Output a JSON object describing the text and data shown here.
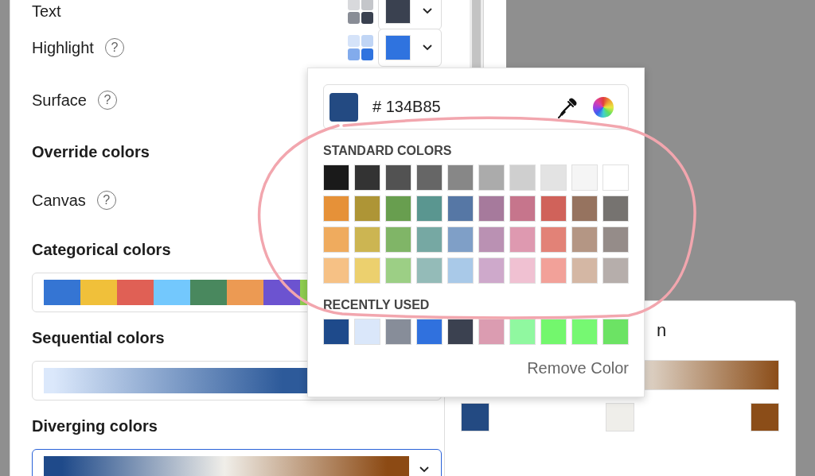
{
  "theme_rows": [
    {
      "kind": "color",
      "label": "Text",
      "color": "#3a4150"
    },
    {
      "kind": "color",
      "label": "Highlight",
      "help": "?",
      "color": "#2f73df"
    },
    {
      "kind": "color",
      "label": "Surface",
      "help": "?"
    },
    {
      "kind": "heading",
      "label": "Override colors"
    },
    {
      "kind": "color",
      "label": "Canvas",
      "help": "?"
    }
  ],
  "palettes": [
    {
      "kind": "categorical",
      "title": "Categorical colors",
      "selected": false,
      "swatches": [
        {
          "color": "#3575d3"
        },
        {
          "color": "#f0c03a"
        },
        {
          "color": "#e06055"
        },
        {
          "color": "#73c8fd"
        },
        {
          "color": "#49885e"
        },
        {
          "color": "#ec9a53"
        },
        {
          "color": "#6c53d0"
        },
        {
          "color": "#8fcf50"
        }
      ]
    },
    {
      "kind": "sequential",
      "title": "Sequential colors",
      "selected": false,
      "swatches": [
        {
          "color": "#dbe8fb"
        },
        {
          "color": "#2d5a9a"
        }
      ]
    },
    {
      "kind": "diverging",
      "title": "Diverging colors",
      "selected": true,
      "swatches": [
        {
          "color": "#1f4a8a"
        },
        {
          "color": "#f0eee9"
        },
        {
          "color": "#8c4a14"
        }
      ]
    }
  ],
  "color_picker": {
    "color": "#234a82",
    "value": "# 134B85",
    "standard_label": "STANDARD COLORS",
    "standard": [
      {
        "color": "#1a1a1a"
      },
      {
        "color": "#333333"
      },
      {
        "color": "#525252"
      },
      {
        "color": "#666666"
      },
      {
        "color": "#878787"
      },
      {
        "color": "#ababab"
      },
      {
        "color": "#cfcfcf"
      },
      {
        "color": "#e3e3e3"
      },
      {
        "color": "#f5f5f5"
      },
      {
        "color": "#ffffff"
      },
      {
        "color": "#e69138"
      },
      {
        "color": "#ae9536"
      },
      {
        "color": "#689e4f"
      },
      {
        "color": "#5a9690"
      },
      {
        "color": "#5677a5"
      },
      {
        "color": "#a67a9c"
      },
      {
        "color": "#c6758c"
      },
      {
        "color": "#d0625a"
      },
      {
        "color": "#96735f"
      },
      {
        "color": "#767370"
      },
      {
        "color": "#efab5e"
      },
      {
        "color": "#ccb552"
      },
      {
        "color": "#80b567"
      },
      {
        "color": "#76a8a3"
      },
      {
        "color": "#7f9fc7"
      },
      {
        "color": "#ba91b3"
      },
      {
        "color": "#de99b0"
      },
      {
        "color": "#e28277"
      },
      {
        "color": "#b49684"
      },
      {
        "color": "#958c89"
      },
      {
        "color": "#f6c185"
      },
      {
        "color": "#ecd06e"
      },
      {
        "color": "#9ccf85"
      },
      {
        "color": "#94bbb8"
      },
      {
        "color": "#a9c9e8"
      },
      {
        "color": "#cea9cb"
      },
      {
        "color": "#f0c1d2"
      },
      {
        "color": "#f2a199"
      },
      {
        "color": "#d4b7a4"
      },
      {
        "color": "#b6aeab"
      }
    ],
    "recent_label": "RECENTLY USED",
    "recent": [
      {
        "color": "#1e4a8b"
      },
      {
        "color": "#dae7fa"
      },
      {
        "color": "#878d99"
      },
      {
        "color": "#3071de"
      },
      {
        "color": "#3b4150"
      },
      {
        "color": "#db9cb1"
      },
      {
        "color": "#90f8a0"
      },
      {
        "color": "#73f76d"
      },
      {
        "color": "#76f872"
      },
      {
        "color": "#6ce364"
      }
    ],
    "remove": "Remove Color"
  },
  "diverging_panel": {
    "heading": "n",
    "stops": [
      {
        "color": "#234a82"
      },
      {
        "color": "#efeeea"
      },
      {
        "color": "#8b4d18"
      }
    ]
  }
}
